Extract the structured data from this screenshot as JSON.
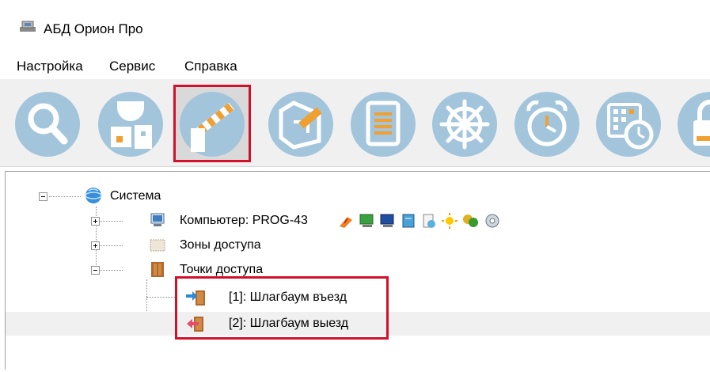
{
  "window": {
    "title": "АБД Орион Про"
  },
  "menu": {
    "items": [
      "Настройка",
      "Сервис",
      "Справка"
    ]
  },
  "toolbar": {
    "buttons": [
      {
        "name": "search-icon"
      },
      {
        "name": "devices-icon"
      },
      {
        "name": "barrier-icon",
        "active": true
      },
      {
        "name": "floor-plan-icon"
      },
      {
        "name": "document-icon"
      },
      {
        "name": "wheel-icon"
      },
      {
        "name": "alarm-clock-icon"
      },
      {
        "name": "schedule-icon"
      },
      {
        "name": "lock-icon"
      }
    ]
  },
  "tree": {
    "root": "Система",
    "computer": "Компьютер: PROG-43",
    "zones": "Зоны доступа",
    "access_points": "Точки доступа",
    "points": [
      "[1]: Шлагбаум въезд",
      "[2]: Шлагбаум выезд"
    ]
  },
  "colors": {
    "icon_circle": "#a3c5dc",
    "highlight": "#d3102a",
    "toolbar_bg": "#f0f0f0"
  }
}
